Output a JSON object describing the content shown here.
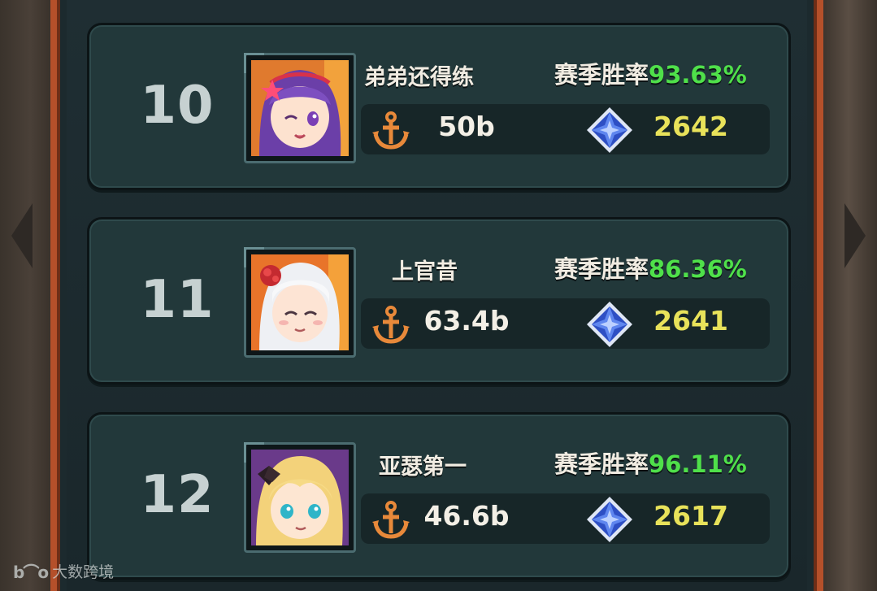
{
  "season_label": "赛季胜率",
  "watermark": {
    "mark": "b⌒o",
    "text": "大数跨境"
  },
  "colors": {
    "rate_green": "#4fe04a",
    "score_yellow": "#e8e25a",
    "frame_orange": "#b5502a"
  },
  "rows": [
    {
      "rank": "10",
      "name": "弟弟还得练",
      "win_rate": "93.63%",
      "power": "50b",
      "score": "2642",
      "avatar": "purple-hair-avatar-icon"
    },
    {
      "rank": "11",
      "name": "上官昔",
      "win_rate": "86.36%",
      "power": "63.4b",
      "score": "2641",
      "avatar": "white-hair-avatar-icon"
    },
    {
      "rank": "12",
      "name": "亚瑟第一",
      "win_rate": "96.11%",
      "power": "46.6b",
      "score": "2617",
      "avatar": "blonde-hair-avatar-icon"
    }
  ]
}
